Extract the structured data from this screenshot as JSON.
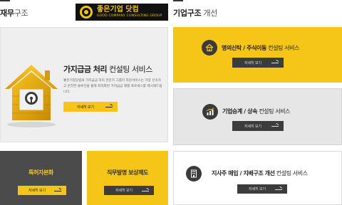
{
  "left_header": {
    "title_bold": "재무",
    "title_light": "구조"
  },
  "right_header": {
    "title_bold": "기업구조",
    "title_light": "개선"
  },
  "logo": {
    "main": "좋은기업 닷컴",
    "sub": "GOOD COMPANY CONSULTING GROUP"
  },
  "main_card": {
    "title_bold": "가지급금 처리",
    "title_light": " 컨설팅 서비스",
    "description": "좋은기업닷컴의 가지급금 처리 전문가 그룹이 자문서비스는 가장 신속하고 안전한 솔루션을 통해 최적화된 가지급금 해결 프로세스를 제시해드립니다.",
    "button": "자세히 보기"
  },
  "patent_card": {
    "title": "특허자본화",
    "button": "자세히 보기"
  },
  "comp_card": {
    "title": "직무발명 보상제도",
    "button": "자세히 보기"
  },
  "trust_card": {
    "title_bold": "명의신탁 / 주식이동",
    "title_light": " 컨설팅 서비스",
    "button": "자세히 보기"
  },
  "succ_card": {
    "title_bold": "기업승계 / 상속",
    "title_light": " 컨설팅 서비스",
    "button": "자세히 보기"
  },
  "holding_card": {
    "title_bold": "지사주 매입 / 지배구조 개선",
    "title_light": " 컨설팅 서비스",
    "button": "자세히 보기"
  },
  "colors": {
    "accent_yellow": "#f5c518",
    "dark_gray": "#4b4b4b",
    "light_gray": "#efefef"
  },
  "icons": [
    "house-lock-icon",
    "home-icon",
    "growth-chart-icon",
    "building-icon",
    "arrow-right-icon"
  ]
}
